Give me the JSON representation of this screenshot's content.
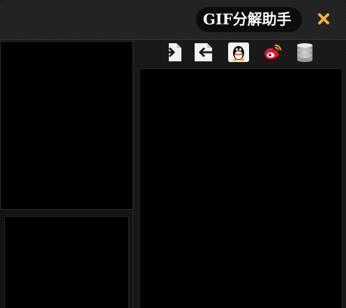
{
  "app": {
    "title": "GIF分解助手"
  },
  "toolbar": {
    "buttons": [
      {
        "name": "import-button",
        "icon": "import-arrow-icon"
      },
      {
        "name": "export-button",
        "icon": "export-arrow-icon"
      },
      {
        "name": "qq-button",
        "icon": "qq-penguin-icon"
      },
      {
        "name": "weibo-button",
        "icon": "weibo-icon"
      },
      {
        "name": "database-button",
        "icon": "database-icon"
      }
    ]
  },
  "colors": {
    "close_icon": "#f2b233",
    "background": "#171717",
    "panel": "#000000",
    "weibo_red": "#e6162d",
    "qq_yellow": "#f6b31c"
  }
}
